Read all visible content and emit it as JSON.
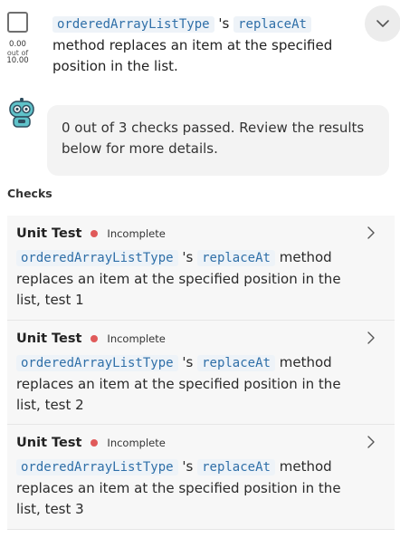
{
  "assignment": {
    "score": "0.00",
    "out_of_label": "out of",
    "max_score": "10.00",
    "code_class": "orderedArrayListType",
    "possessive": "'s",
    "code_method": "replaceAt",
    "description": "method replaces an item at the specified position in the list."
  },
  "bot": {
    "message": "0 out of 3 checks passed. Review the results below for more details."
  },
  "checks": {
    "heading": "Checks",
    "items": [
      {
        "kind": "Unit Test",
        "status": "Incomplete",
        "code_class": "orderedArrayListType",
        "possessive": "'s",
        "code_method": "replaceAt",
        "description": "method replaces an item at the specified position in the list, test 1"
      },
      {
        "kind": "Unit Test",
        "status": "Incomplete",
        "code_class": "orderedArrayListType",
        "possessive": "'s",
        "code_method": "replaceAt",
        "description": "method replaces an item at the specified position in the list, test 2"
      },
      {
        "kind": "Unit Test",
        "status": "Incomplete",
        "code_class": "orderedArrayListType",
        "possessive": "'s",
        "code_method": "replaceAt",
        "description": "method replaces an item at the specified position in the list, test 3"
      }
    ]
  },
  "colors": {
    "status_incomplete": "#e05a5a",
    "code_text": "#2f6fa8"
  },
  "icons": {
    "collapse": "chevron-down-icon",
    "expand": "chevron-right-icon",
    "assistant": "robot-icon"
  }
}
